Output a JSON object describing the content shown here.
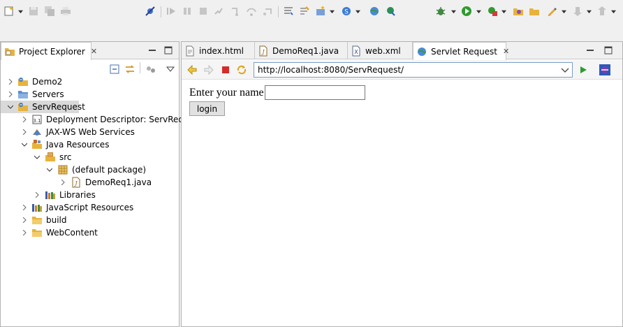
{
  "explorer": {
    "title": "Project Explorer",
    "tree": [
      {
        "label": "Demo2",
        "icon": "project-icon"
      },
      {
        "label": "Servers",
        "icon": "folder-icon"
      },
      {
        "label": "ServRequest",
        "icon": "project-icon"
      },
      {
        "label": "Deployment Descriptor: ServReques",
        "icon": "deployment-descriptor-icon"
      },
      {
        "label": "JAX-WS Web Services",
        "icon": "web-services-icon"
      },
      {
        "label": "Java Resources",
        "icon": "java-resources-icon"
      },
      {
        "label": "src",
        "icon": "source-folder-icon"
      },
      {
        "label": "(default package)",
        "icon": "package-icon"
      },
      {
        "label": "DemoReq1.java",
        "icon": "java-file-icon"
      },
      {
        "label": "Libraries",
        "icon": "libraries-icon"
      },
      {
        "label": "JavaScript Resources",
        "icon": "libraries-icon"
      },
      {
        "label": "build",
        "icon": "folder-icon"
      },
      {
        "label": "WebContent",
        "icon": "folder-icon"
      }
    ]
  },
  "editor": {
    "tabs": [
      {
        "label": "index.html",
        "icon": "html-file-icon"
      },
      {
        "label": "DemoReq1.java",
        "icon": "java-file-icon"
      },
      {
        "label": "web.xml",
        "icon": "xml-file-icon"
      },
      {
        "label": "Servlet Request",
        "icon": "browser-icon",
        "active": true
      }
    ]
  },
  "browser": {
    "url": "http://localhost:8080/ServRequest/",
    "page": {
      "name_label": "Enter your name",
      "name_value": "",
      "login_label": "login"
    }
  },
  "colors": {
    "accent": "#2a63c4",
    "selection": "#d9d9d9",
    "background": "#f0f0f0"
  }
}
